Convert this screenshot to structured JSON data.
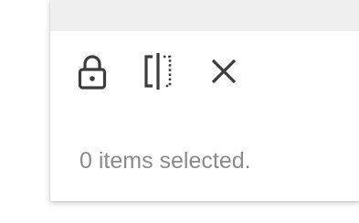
{
  "toolbar": {
    "icons": [
      "lock-icon",
      "split-column-icon",
      "close-icon"
    ]
  },
  "status": {
    "selection_text": "0 items selected."
  },
  "colors": {
    "header_bg": "#efefef",
    "icon": "#3c3c3c",
    "status_text": "#8a8a8a"
  }
}
